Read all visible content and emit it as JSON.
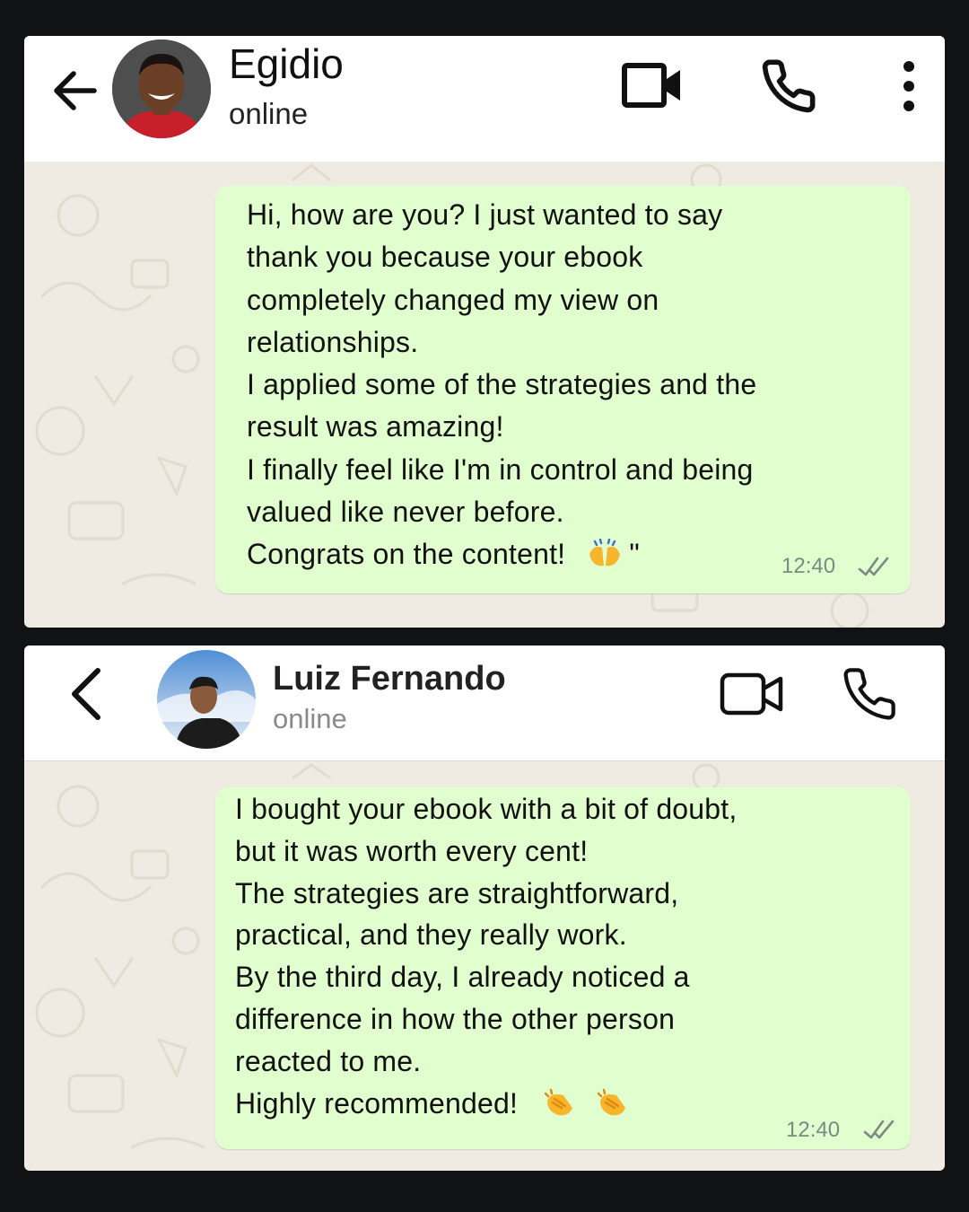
{
  "chats": [
    {
      "contact_name": "Egidio",
      "status": "online",
      "message_lines": [
        "Hi, how are you? I just wanted to say",
        "thank you because your ebook",
        "completely changed my view on",
        "relationships.",
        "I applied some of the strategies and the",
        "result was amazing!",
        "I finally feel like I'm in control and being",
        "valued like never before.",
        "Congrats on the content!"
      ],
      "closing_quote": "\"",
      "emoji": "raising-hands-emoji",
      "time": "12:40",
      "read_receipt": "double-check-icon"
    },
    {
      "contact_name": "Luiz Fernando",
      "status": "online",
      "message_lines": [
        "I bought your ebook with a bit of doubt,",
        "but it was worth every cent!",
        "The strategies are straightforward,",
        "practical, and they really work.",
        "By the third day, I already noticed a",
        "difference in how the other person",
        "reacted to me.",
        "Highly recommended!"
      ],
      "emoji": "clapping-hands-emoji",
      "time": "12:40",
      "read_receipt": "double-check-icon"
    }
  ],
  "colors": {
    "page_background": "#111213",
    "chat_background": "#efeae2",
    "bubble": "#e1fecf",
    "header": "#ffffff",
    "status_gray": "#8a8a8a",
    "timestamp": "#7b8a83"
  }
}
